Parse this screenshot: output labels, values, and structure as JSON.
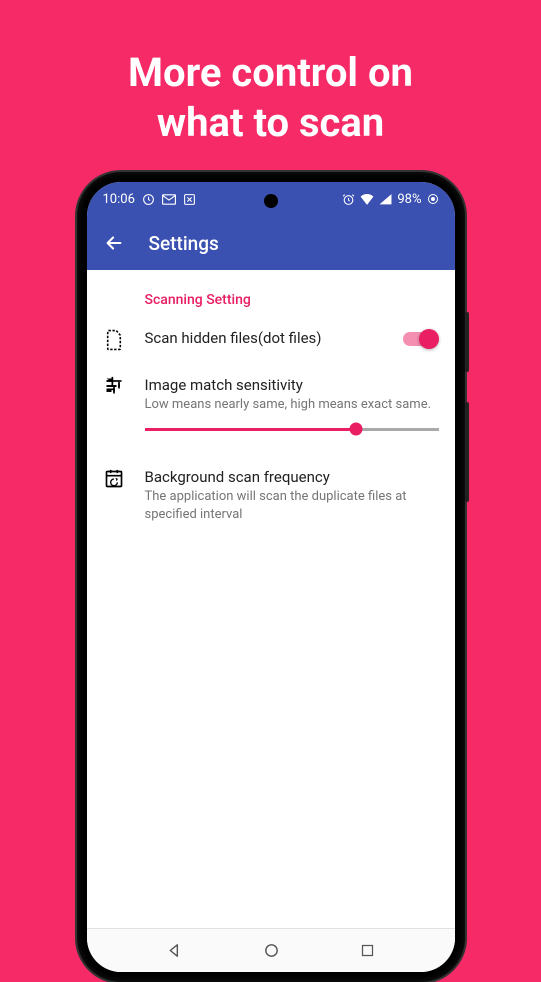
{
  "promo": {
    "line1": "More control on",
    "line2": "what to scan"
  },
  "statusBar": {
    "time": "10:06",
    "battery": "98%"
  },
  "appBar": {
    "title": "Settings"
  },
  "settings": {
    "sectionHeader": "Scanning Setting",
    "hiddenFiles": {
      "title": "Scan hidden files(dot files)",
      "enabled": true
    },
    "sensitivity": {
      "title": "Image match sensitivity",
      "subtitle": "Low means nearly same, high means exact same.",
      "value": 72
    },
    "bgScan": {
      "title": "Background scan frequency",
      "subtitle": "The application will scan the duplicate files at specified interval"
    }
  }
}
